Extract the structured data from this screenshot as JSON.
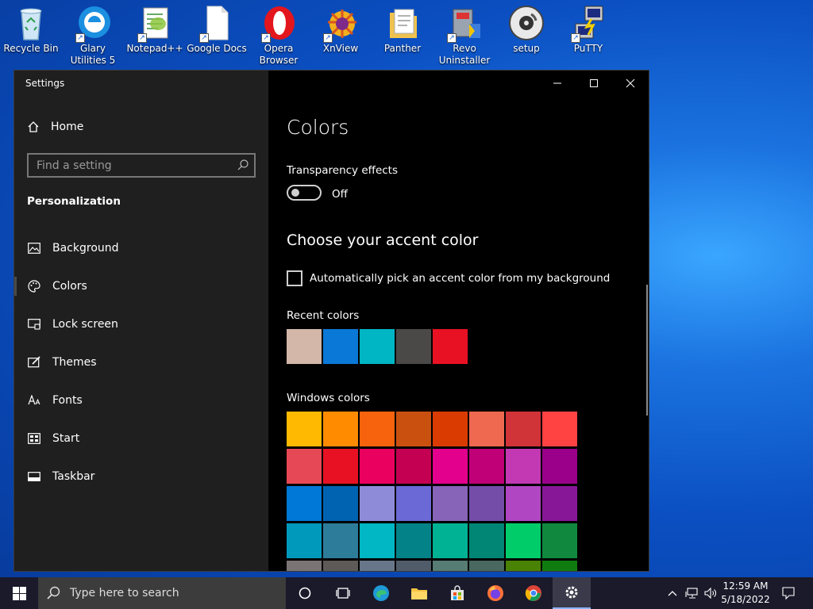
{
  "desktop": {
    "icons": [
      {
        "label": "Recycle Bin",
        "icon": "recycle-bin-icon"
      },
      {
        "label": "Glary Utilities 5",
        "icon": "glary-utilities-icon"
      },
      {
        "label": "Notepad++",
        "icon": "notepad-plus-plus-icon"
      },
      {
        "label": "Google Docs",
        "icon": "google-docs-icon"
      },
      {
        "label": "Opera Browser",
        "icon": "opera-icon"
      },
      {
        "label": "XnView",
        "icon": "xnview-icon"
      },
      {
        "label": "Panther",
        "icon": "panther-icon"
      },
      {
        "label": "Revo Uninstaller",
        "icon": "revo-uninstaller-icon"
      },
      {
        "label": "setup",
        "icon": "setup-disc-icon"
      },
      {
        "label": "PuTTY",
        "icon": "putty-icon"
      }
    ]
  },
  "window": {
    "title": "Settings",
    "controls": {
      "minimize": "minimize-icon",
      "maximize": "maximize-icon",
      "close": "close-icon"
    }
  },
  "sidebar": {
    "home_label": "Home",
    "search_placeholder": "Find a setting",
    "section_title": "Personalization",
    "items": [
      {
        "label": "Background",
        "icon": "picture-icon"
      },
      {
        "label": "Colors",
        "icon": "palette-icon",
        "active": true
      },
      {
        "label": "Lock screen",
        "icon": "lock-screen-icon"
      },
      {
        "label": "Themes",
        "icon": "brush-icon"
      },
      {
        "label": "Fonts",
        "icon": "fonts-icon"
      },
      {
        "label": "Start",
        "icon": "start-layout-icon"
      },
      {
        "label": "Taskbar",
        "icon": "taskbar-icon"
      }
    ]
  },
  "content": {
    "title": "Colors",
    "transparency_label": "Transparency effects",
    "transparency_state": "Off",
    "accent_heading": "Choose your accent color",
    "auto_pick_label": "Automatically pick an accent color from my background",
    "recent_label": "Recent colors",
    "recent_colors": [
      "#d3b7a8",
      "#0a78d6",
      "#00b5c4",
      "#4b4848",
      "#e81123"
    ],
    "windows_label": "Windows colors",
    "windows_colors": [
      "#ffb900",
      "#ff8c00",
      "#f7630c",
      "#ca5010",
      "#da3b01",
      "#ef6950",
      "#d13438",
      "#ff4343",
      "#e74856",
      "#e81123",
      "#ea005e",
      "#c30052",
      "#e3008c",
      "#bf0077",
      "#c239b3",
      "#9a0089",
      "#0078d7",
      "#0063b1",
      "#8e8cd8",
      "#6b69d6",
      "#8764b8",
      "#744da9",
      "#b146c2",
      "#881798",
      "#0099bc",
      "#2d7d9a",
      "#00b7c3",
      "#038387",
      "#00b294",
      "#018574",
      "#00cc6a",
      "#10893e",
      "#7a7574",
      "#5d5a58",
      "#68768a",
      "#515c6b",
      "#567c73",
      "#486860",
      "#498205",
      "#107c10"
    ]
  },
  "taskbar": {
    "search_placeholder": "Type here to search",
    "apps": [
      "task-view-icon",
      "edge-icon",
      "file-explorer-icon",
      "store-icon",
      "firefox-icon",
      "chrome-icon",
      "settings-gear-icon"
    ],
    "time": "12:59 AM",
    "date": "5/18/2022"
  }
}
